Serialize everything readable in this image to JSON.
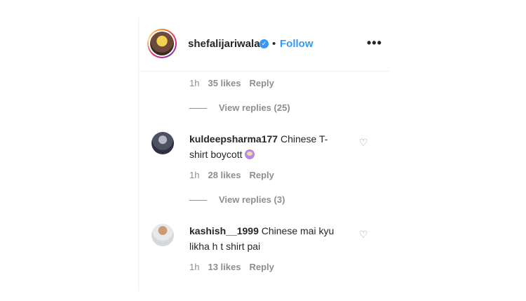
{
  "header": {
    "username": "shefalijariwala",
    "verified_glyph": "✓",
    "separator": "•",
    "follow_label": "Follow",
    "more_label": "•••"
  },
  "top_comment": {
    "time": "1h",
    "likes": "35 likes",
    "reply_label": "Reply",
    "view_replies": "View replies (25)"
  },
  "comments": [
    {
      "username": "kuldeepsharma177",
      "text_part1": "Chinese T-",
      "text_part2": "shirt boycott",
      "emoji": "woman-emoji",
      "time": "1h",
      "likes": "28 likes",
      "reply_label": "Reply",
      "view_replies": "View replies (3)",
      "like_icon": "♡"
    },
    {
      "username": "kashish__1999",
      "text_part1": "Chinese mai kyu",
      "text_part2": "likha h t shirt pai",
      "time": "1h",
      "likes": "13 likes",
      "reply_label": "Reply",
      "like_icon": "♡"
    }
  ],
  "colors": {
    "link_blue": "#3897f0",
    "text": "#262626",
    "muted": "#8e8e8e",
    "border": "#efefef"
  }
}
